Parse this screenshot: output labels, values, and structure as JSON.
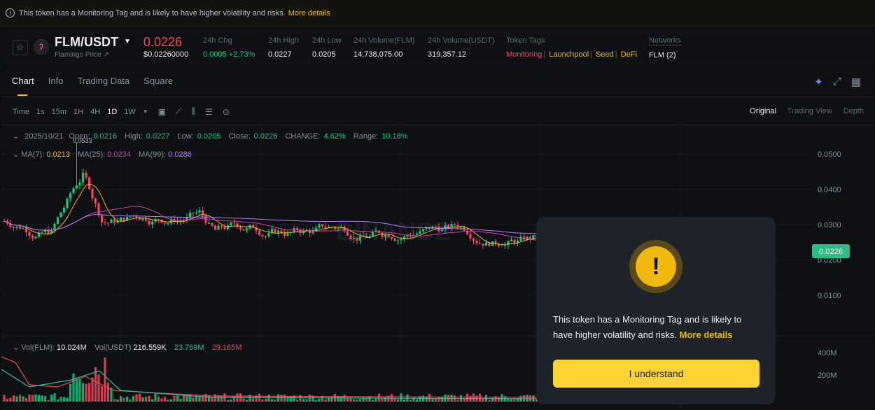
{
  "banner": {
    "text": "This token has a Monitoring Tag and is likely to have higher volatility and risks.",
    "link": "More details"
  },
  "ticker": {
    "pair": "FLM/USDT",
    "sub": "Flamingo Price ↗",
    "price": "0.0226",
    "price_usd": "$0.02260000",
    "stats": [
      {
        "label": "24h Chg",
        "value": "0.0005 +2.73%"
      },
      {
        "label": "24h High",
        "value": "0.0227"
      },
      {
        "label": "24h Low",
        "value": "0.0205"
      },
      {
        "label": "24h Volume(FLM)",
        "value": "14,738,075.00"
      },
      {
        "label": "24h Volume(USDT)",
        "value": "319,357.12"
      }
    ],
    "token_tags_label": "Token Tags",
    "tags": [
      "Monitoring",
      "Launchpool",
      "Seed",
      "DeFi"
    ],
    "networks_label": "Networks",
    "networks_value": "FLM (2)"
  },
  "tabs": [
    "Chart",
    "Info",
    "Trading Data",
    "Square"
  ],
  "intervals": [
    "Time",
    "1s",
    "15m",
    "1H",
    "4H",
    "1D",
    "1W"
  ],
  "active_interval": "1D",
  "views": [
    "Original",
    "Trading View",
    "Depth"
  ],
  "ohlc": {
    "date": "2025/10/21",
    "open_label": "Open:",
    "open": "0.0216",
    "high_label": "High:",
    "high": "0.0227",
    "low_label": "Low:",
    "low": "0.0205",
    "close_label": "Close:",
    "close": "0.0226",
    "change_label": "CHANGE:",
    "change": "4.62%",
    "range_label": "Range:",
    "range": "10.18%"
  },
  "ma": {
    "ma7_label": "MA(7):",
    "ma7": "0.0213",
    "ma25_label": "MA(25):",
    "ma25": "0.0234",
    "ma99_label": "MA(99):",
    "ma99": "0.0286"
  },
  "price_axis": [
    "0.0500",
    "0.0400",
    "0.0300",
    "0.0200",
    "0.0100"
  ],
  "current_price_tag": "0.0226",
  "peak_label": "0.0533",
  "volume": {
    "vol_flm_label": "Vol(FLM):",
    "vol_flm": "10.024M",
    "vol_usdt_label": "Vol(USDT)",
    "vol_usdt": "216.559K",
    "ma_a": "23.769M",
    "ma_b": "29.165M",
    "axis": [
      "400M",
      "200M"
    ]
  },
  "dialog": {
    "text": "This token has a Monitoring Tag and is likely to have higher volatility and risks.",
    "link": "More details",
    "button": "I understand"
  },
  "watermark": "BINANCE",
  "colors": {
    "up": "#0ecb81",
    "down": "#f6465d",
    "accent": "#f0b90b",
    "button": "#fcd535"
  }
}
